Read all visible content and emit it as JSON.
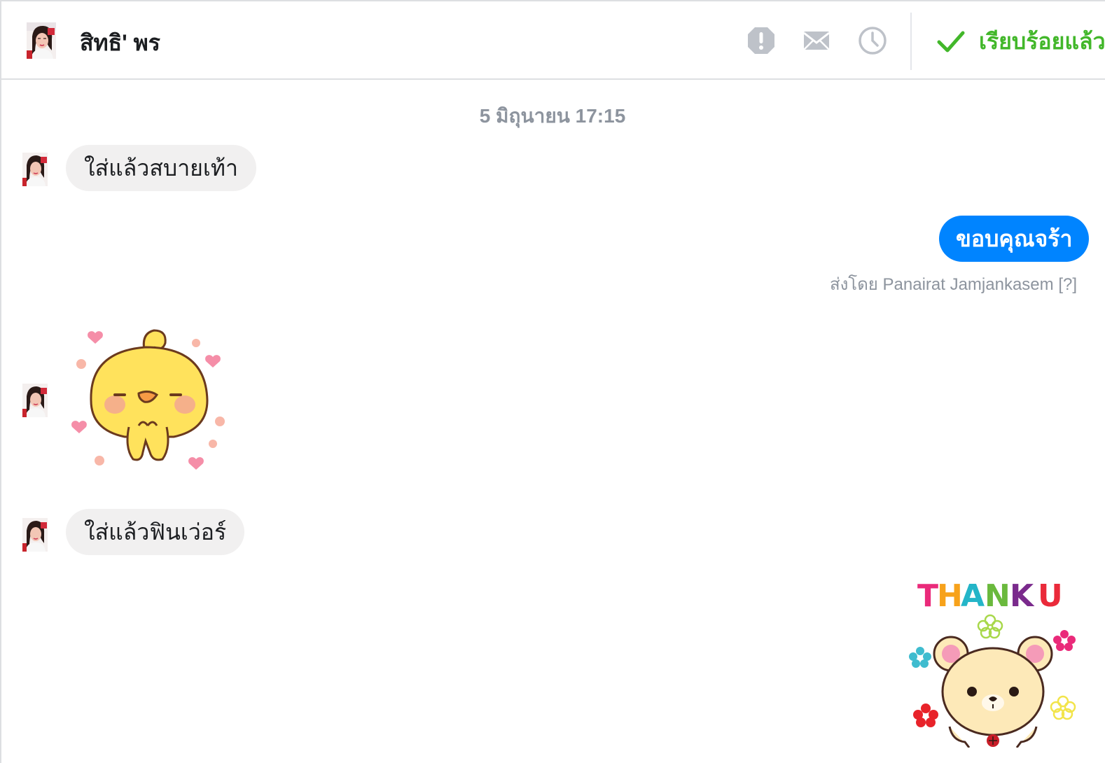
{
  "header": {
    "contact_name": "สิทธิ' พร",
    "done_label": "เรียบร้อยแล้ว",
    "icons": [
      "alert-icon",
      "mail-icon",
      "clock-icon",
      "checkmark-icon"
    ]
  },
  "conversation": {
    "timestamp": "5 มิถุนายน 17:15",
    "messages": [
      {
        "direction": "incoming",
        "type": "text",
        "text": "ใส่แล้วสบายเท้า"
      },
      {
        "direction": "outgoing",
        "type": "text",
        "text": "ขอบคุณจร้า"
      },
      {
        "direction": "incoming",
        "type": "sticker",
        "sticker": "yellow-chick-hearts-sticker"
      },
      {
        "direction": "incoming",
        "type": "text",
        "text": "ใส่แล้วฟินเว่อร์"
      },
      {
        "direction": "outgoing",
        "type": "sticker",
        "sticker": "thank-u-bear-sticker",
        "sticker_text": "THANK U"
      }
    ],
    "sent_by": {
      "prefix": "ส่งโดย",
      "name": "Panairat Jamjankasem",
      "help": "[?]"
    }
  },
  "colors": {
    "outgoing_bubble": "#0084ff",
    "incoming_bubble": "#f1f0f0",
    "done_green": "#42b72a",
    "icon_gray": "#bec2c9",
    "muted_text": "#8d949e"
  }
}
